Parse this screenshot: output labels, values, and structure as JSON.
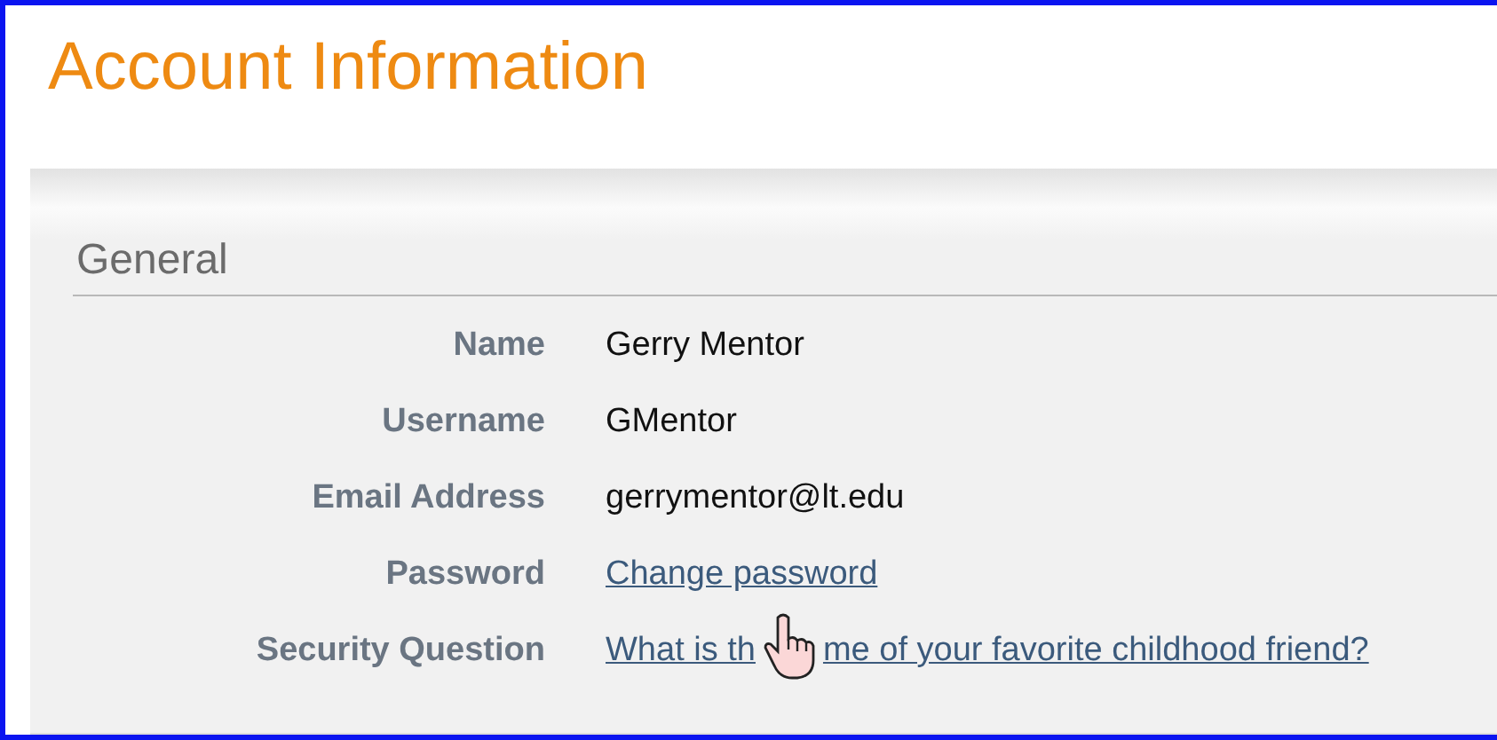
{
  "page": {
    "title": "Account Information"
  },
  "section": {
    "title": "General",
    "rows": [
      {
        "label": "Name",
        "kind": "text",
        "value": "Gerry Mentor"
      },
      {
        "label": "Username",
        "kind": "text",
        "value": "GMentor"
      },
      {
        "label": "Email Address",
        "kind": "text",
        "value": "gerrymentor@lt.edu"
      },
      {
        "label": "Password",
        "kind": "link",
        "value": "Change password"
      },
      {
        "label": "Security Question",
        "kind": "covered-link",
        "parts": [
          "What is th",
          "me of your favorite childhood friend?"
        ]
      }
    ]
  }
}
